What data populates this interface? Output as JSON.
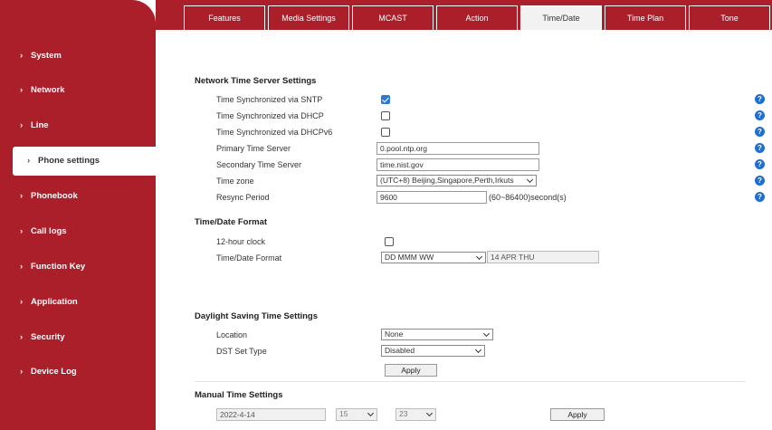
{
  "tabs": [
    "Features",
    "Media Settings",
    "MCAST",
    "Action",
    "Time/Date",
    "Time Plan",
    "Tone"
  ],
  "active_tab": "Time/Date",
  "sidebar": {
    "items": [
      "System",
      "Network",
      "Line",
      "Phone settings",
      "Phonebook",
      "Call logs",
      "Function Key",
      "Application",
      "Security",
      "Device Log"
    ],
    "active": "Phone settings"
  },
  "network_time": {
    "title": "Network Time Server Settings",
    "sntp_label": "Time Synchronized via SNTP",
    "sntp_checked": true,
    "dhcp_label": "Time Synchronized via DHCP",
    "dhcp_checked": false,
    "dhcpv6_label": "Time Synchronized via DHCPv6",
    "dhcpv6_checked": false,
    "primary_label": "Primary Time Server",
    "primary_value": "0.pool.ntp.org",
    "secondary_label": "Secondary Time Server",
    "secondary_value": "time.nist.gov",
    "timezone_label": "Time zone",
    "timezone_value": "(UTC+8) Beijing,Singapore,Perth,Irkuts",
    "resync_label": "Resync Period",
    "resync_value": "9600",
    "resync_unit": "(60~86400)second(s)"
  },
  "time_format": {
    "title": "Time/Date Format",
    "clock12_label": "12-hour clock",
    "clock12_checked": false,
    "format_label": "Time/Date Format",
    "format_value": "DD MMM WW",
    "format_preview": "14 APR THU"
  },
  "dst": {
    "title": "Daylight Saving Time Settings",
    "location_label": "Location",
    "location_value": "None",
    "type_label": "DST Set Type",
    "type_value": "Disabled",
    "apply_label": "Apply"
  },
  "manual": {
    "title": "Manual Time Settings",
    "date_value": "2022-4-14",
    "hour_value": "15",
    "minute_value": "23",
    "apply_label": "Apply"
  },
  "help_glyph": "?",
  "colors": {
    "brand": "#ab1f2b",
    "accent": "#1e6fcf"
  },
  "icons": {
    "nav_chevron": "chevron-right-icon",
    "help": "help-icon",
    "dropdown": "chevron-down-icon"
  }
}
